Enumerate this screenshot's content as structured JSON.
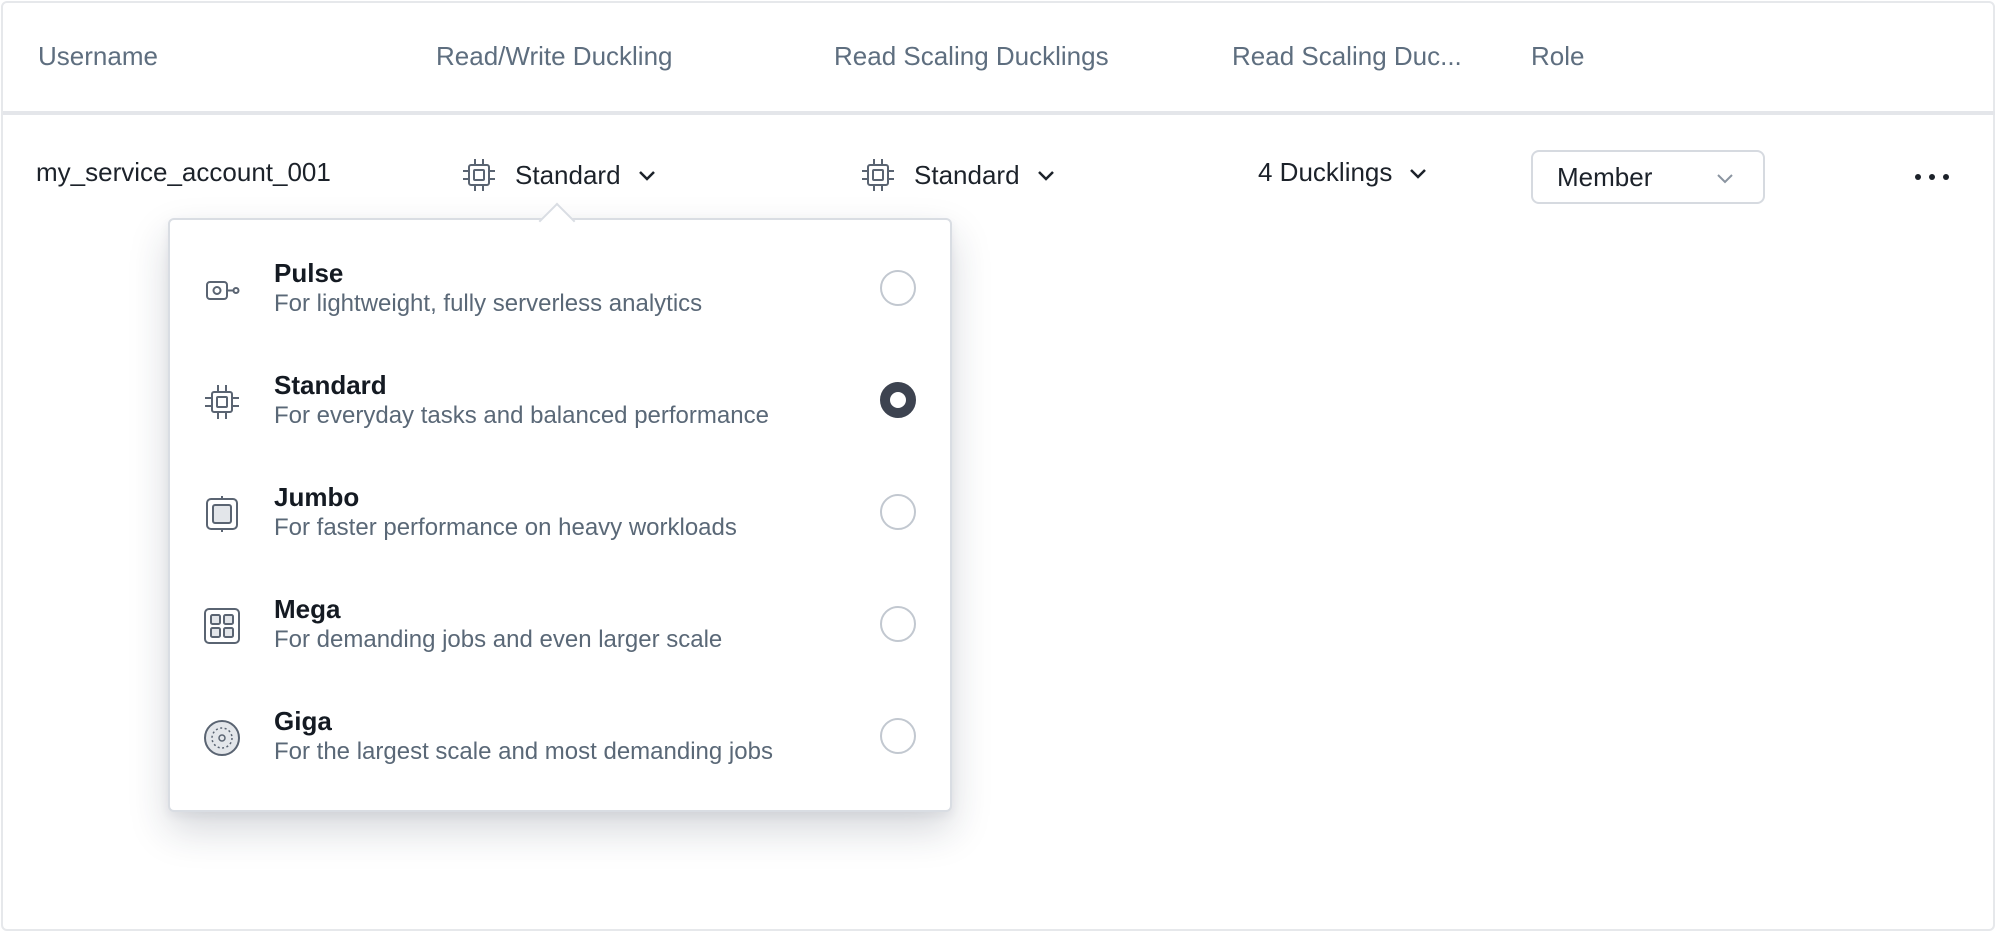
{
  "table": {
    "headers": {
      "username": "Username",
      "rw_duckling": "Read/Write Duckling",
      "rs_ducklings": "Read Scaling Ducklings",
      "rs_duc_count": "Read Scaling Duc...",
      "role": "Role"
    },
    "row": {
      "username": "my_service_account_001",
      "rw_duckling": "Standard",
      "rs_ducklings": "Standard",
      "rs_count": "4 Ducklings",
      "role": "Member"
    }
  },
  "dropdown": {
    "selected": "Standard",
    "options": [
      {
        "title": "Pulse",
        "description": "For lightweight, fully serverless analytics",
        "icon": "pulse-icon"
      },
      {
        "title": "Standard",
        "description": "For everyday tasks and balanced performance",
        "icon": "chip-icon"
      },
      {
        "title": "Jumbo",
        "description": "For faster performance on heavy workloads",
        "icon": "jumbo-icon"
      },
      {
        "title": "Mega",
        "description": "For demanding jobs and even larger scale",
        "icon": "grid-icon"
      },
      {
        "title": "Giga",
        "description": "For the largest scale and most demanding jobs",
        "icon": "giga-icon"
      }
    ]
  },
  "colors": {
    "header_text": "#5e6e7f",
    "body_text": "#1c222a",
    "radio_selected": "#3d4350",
    "border": "#d9dde3"
  }
}
